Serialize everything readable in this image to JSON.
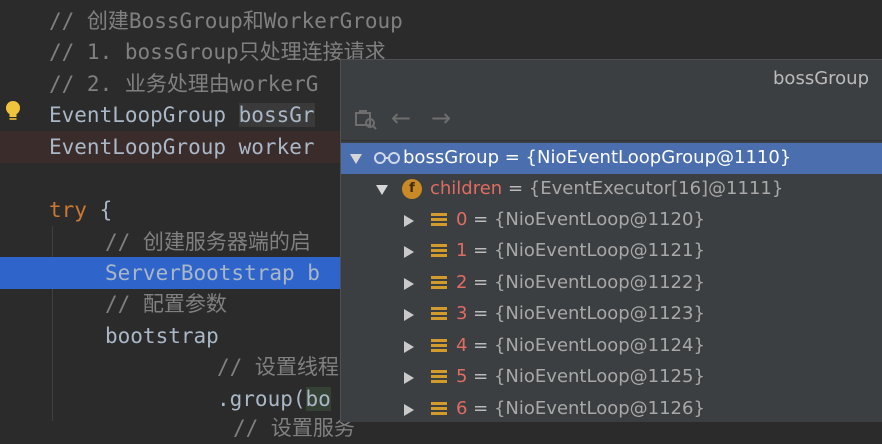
{
  "editor": {
    "lines": [
      {
        "text": "// 创建BossGroup和WorkerGroup"
      },
      {
        "text": "// 1. bossGroup只处理连接请求"
      },
      {
        "text": "// 2. 业务处理由workerG"
      },
      {
        "a": "EventLoopGroup ",
        "b": "bossGr"
      },
      {
        "text": "EventLoopGroup worker"
      },
      {
        "kw": "try",
        "rest": " {"
      },
      {
        "text": "// 创建服务器端的启"
      },
      {
        "text": "ServerBootstrap b"
      },
      {
        "text": "// 配置参数"
      },
      {
        "text": "bootstrap"
      },
      {
        "text": "// 设置线程"
      },
      {
        "a": ".group(",
        "b": "bo"
      },
      {
        "text": "// 设置服务"
      }
    ]
  },
  "popup": {
    "title": "bossGroup",
    "toolbar": {
      "icons": [
        "evaluate-icon",
        "back-arrow-icon",
        "forward-arrow-icon"
      ],
      "back": "←",
      "forward": "→"
    },
    "tree": {
      "root": {
        "name": "bossGroup",
        "eq": " = ",
        "value": "{NioEventLoopGroup@1110}"
      },
      "children": {
        "name": "children",
        "eq": " = ",
        "value": "{EventExecutor[16]@1111}",
        "badge": "f"
      },
      "items": [
        {
          "index": "0",
          "eq": " = ",
          "value": "{NioEventLoop@1120}"
        },
        {
          "index": "1",
          "eq": " = ",
          "value": "{NioEventLoop@1121}"
        },
        {
          "index": "2",
          "eq": " = ",
          "value": "{NioEventLoop@1122}"
        },
        {
          "index": "3",
          "eq": " = ",
          "value": "{NioEventLoop@1123}"
        },
        {
          "index": "4",
          "eq": " = ",
          "value": "{NioEventLoop@1124}"
        },
        {
          "index": "5",
          "eq": " = ",
          "value": "{NioEventLoop@1125}"
        },
        {
          "index": "6",
          "eq": " = ",
          "value": "{NioEventLoop@1126}"
        }
      ]
    }
  },
  "colors": {
    "editor_bg": "#2b2b2b",
    "comment": "#808080",
    "keyword": "#cc7832",
    "selection_line": "#2f65ca",
    "tree_selection": "#4b6eaf",
    "field_name": "#e06c61"
  }
}
